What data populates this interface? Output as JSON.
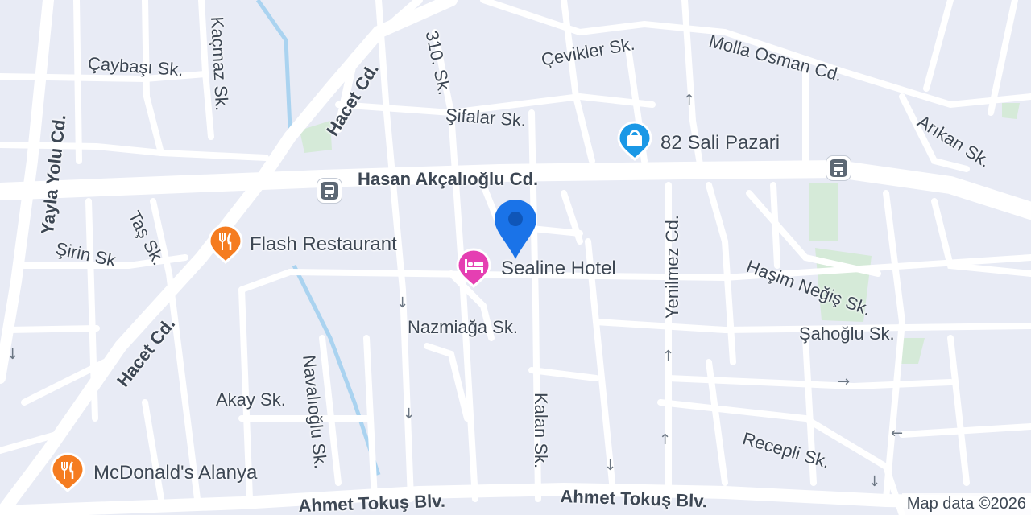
{
  "map": {
    "colors": {
      "background": "#e8ebf5",
      "road": "#ffffff",
      "park": "#d5ead8",
      "water": "#aad3f0",
      "label": "#3d4754",
      "restaurant_pin": "#f57c20",
      "hotel_pin": "#e53fb2",
      "shopping_pin": "#1a98e6",
      "location_marker": "#1a73e8"
    },
    "streets": [
      {
        "name": "Hasan Akçalıoğlu Cd.",
        "weight": "bold"
      },
      {
        "name": "Hacet Cd.",
        "weight": "bold"
      },
      {
        "name": "Hacet Cd.",
        "weight": "bold"
      },
      {
        "name": "Yayla Yolu Cd.",
        "weight": "bold"
      },
      {
        "name": "Ahmet Tokuş Blv.",
        "weight": "bold"
      },
      {
        "name": "Ahmet Tokuş Blv.",
        "weight": "bold"
      },
      {
        "name": "Çaybaşı Sk.",
        "weight": "normal"
      },
      {
        "name": "Kaçmaz Sk.",
        "weight": "normal"
      },
      {
        "name": "310. Sk.",
        "weight": "normal"
      },
      {
        "name": "Şifalar Sk.",
        "weight": "normal"
      },
      {
        "name": "Çevikler Sk.",
        "weight": "normal"
      },
      {
        "name": "Molla Osman Cd.",
        "weight": "normal"
      },
      {
        "name": "Arıkan Sk.",
        "weight": "normal"
      },
      {
        "name": "Taş Sk.",
        "weight": "normal"
      },
      {
        "name": "Şirin Sk",
        "weight": "normal"
      },
      {
        "name": "Yenilmez Cd.",
        "weight": "normal"
      },
      {
        "name": "Haşim Neğiş Sk.",
        "weight": "normal"
      },
      {
        "name": "Nazmiağa Sk.",
        "weight": "normal"
      },
      {
        "name": "Şahoğlu Sk.",
        "weight": "normal"
      },
      {
        "name": "Akay Sk.",
        "weight": "normal"
      },
      {
        "name": "Navalıoğlu Sk.",
        "weight": "normal"
      },
      {
        "name": "Kalan Sk.",
        "weight": "normal"
      },
      {
        "name": "Recepli Sk.",
        "weight": "normal"
      }
    ],
    "pois": [
      {
        "name": "82 Sali Pazari",
        "icon": "shopping-bag-icon"
      },
      {
        "name": "Flash Restaurant",
        "icon": "restaurant-icon"
      },
      {
        "name": "Sealine Hotel",
        "icon": "hotel-bed-icon"
      },
      {
        "name": "McDonald's Alanya",
        "icon": "restaurant-icon"
      }
    ],
    "transit": [
      {
        "icon": "bus-stop-icon"
      },
      {
        "icon": "bus-stop-icon"
      }
    ],
    "current_location": {
      "icon": "location-pin-icon"
    },
    "attribution": "Map data ©2026"
  }
}
